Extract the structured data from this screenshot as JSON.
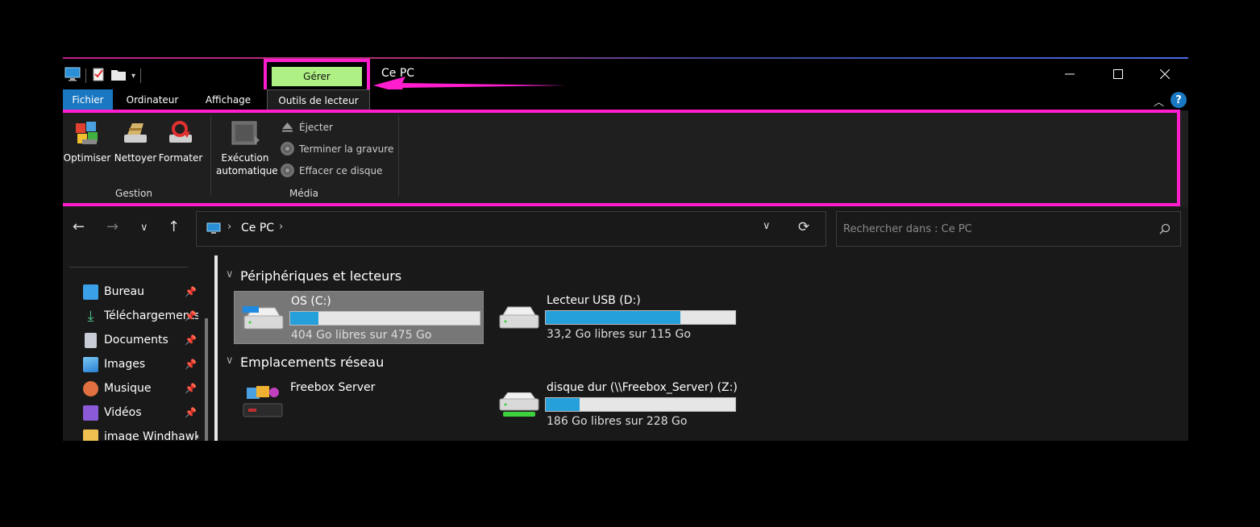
{
  "titlebar": {
    "title": "Ce PC",
    "manage_label": "Gérer"
  },
  "tabs": {
    "file": "Fichier",
    "computer": "Ordinateur",
    "view": "Affichage",
    "drive_tools": "Outils de lecteur",
    "help": "?"
  },
  "ribbon": {
    "optimize": "Optimiser",
    "clean": "Nettoyer",
    "format": "Formater",
    "autoplay_line1": "Exécution",
    "autoplay_line2": "automatique",
    "eject": "Éjecter",
    "finish_burn": "Terminer la gravure",
    "erase_disc": "Effacer ce disque",
    "group_management": "Gestion",
    "group_media": "Média"
  },
  "address": {
    "crumb": "Ce PC",
    "search_placeholder": "Rechercher dans : Ce PC"
  },
  "sidebar": {
    "items": [
      {
        "label": "Bureau",
        "icon": "desktop-icon",
        "color": "#3aa0e8"
      },
      {
        "label": "Téléchargements",
        "icon": "download-icon",
        "color": "#4ec28a"
      },
      {
        "label": "Documents",
        "icon": "document-icon",
        "color": "#c8ccd6"
      },
      {
        "label": "Images",
        "icon": "pictures-icon",
        "color": "#4aa8e8"
      },
      {
        "label": "Musique",
        "icon": "music-icon",
        "color": "#e07040"
      },
      {
        "label": "Vidéos",
        "icon": "videos-icon",
        "color": "#8a5ad8"
      },
      {
        "label": "image Windhawk",
        "icon": "folder-icon",
        "color": "#f0c050"
      }
    ]
  },
  "content": {
    "section_devices": "Périphériques et lecteurs",
    "section_network": "Emplacements réseau",
    "drives": [
      {
        "name": "OS (C:)",
        "free": "404 Go libres sur 475 Go",
        "used_fraction": 0.15
      },
      {
        "name": "Lecteur USB (D:)",
        "free": "33,2 Go libres sur 115 Go",
        "used_fraction": 0.71
      }
    ],
    "network": [
      {
        "name": "Freebox Server"
      },
      {
        "name": "disque dur (\\\\Freebox_Server) (Z:)",
        "free": "186 Go libres sur 228 Go",
        "used_fraction": 0.18
      }
    ]
  },
  "colors": {
    "highlight": "#ff1dce",
    "manage_bg": "#aef084",
    "accent": "#1a78c2",
    "bar_fill": "#26a0da"
  }
}
